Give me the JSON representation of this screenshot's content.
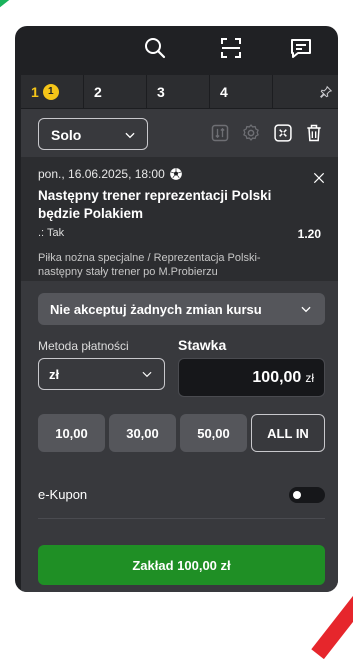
{
  "tabs": [
    {
      "label": "1",
      "badge": "1"
    },
    {
      "label": "2"
    },
    {
      "label": "3"
    },
    {
      "label": "4"
    }
  ],
  "bet_type": {
    "selected": "Solo"
  },
  "bet": {
    "datetime": "pon., 16.06.2025, 18:00",
    "sport_icon": "soccer-ball-icon",
    "title": "Następny trener reprezentacji Polski będzie Polakiem",
    "selection": ".: Tak",
    "odds": "1.20",
    "description": "Piłka nożna specjalne / Reprezentacja Polski- następny stały trener po M.Probierzu"
  },
  "odds_change": {
    "selected": "Nie akceptuj żadnych zmian kursu"
  },
  "payment": {
    "label": "Metoda płatności",
    "selected": "zł"
  },
  "stake": {
    "label": "Stawka",
    "value": "100,00",
    "currency": "zł"
  },
  "quick_stakes": [
    "10,00",
    "30,00",
    "50,00",
    "ALL IN"
  ],
  "ekupon": {
    "label": "e-Kupon",
    "enabled": false
  },
  "place_bet": {
    "label": "Zakład 100,00 zł"
  },
  "colors": {
    "accent": "#f5c518",
    "primary_button": "#1f8f25",
    "background": "#202124"
  }
}
